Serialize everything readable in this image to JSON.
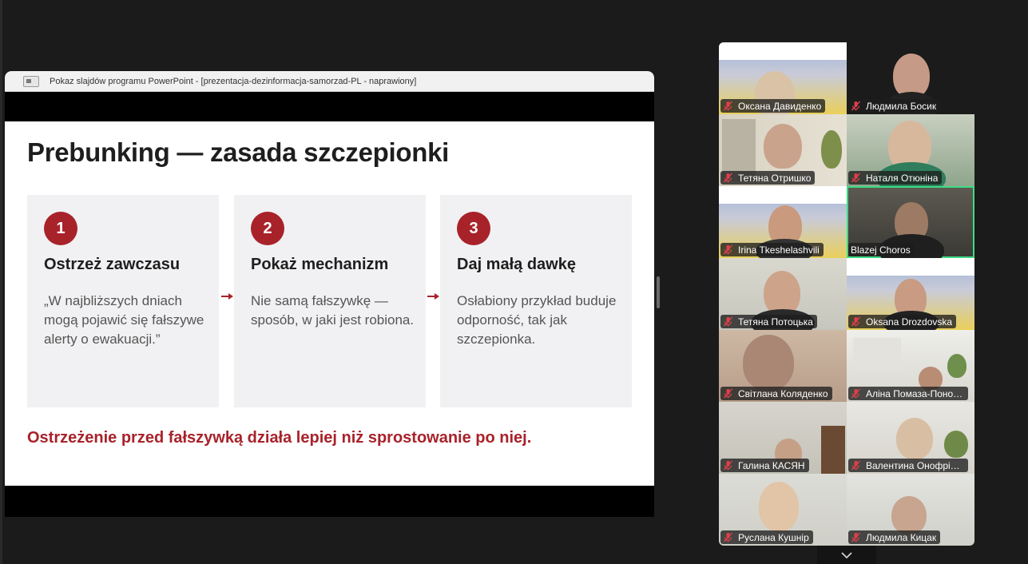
{
  "share": {
    "window_title": "Pokaz slajdów programu PowerPoint - [prezentacja-dezinformacja-samorzad-PL  -  naprawiony]"
  },
  "slide": {
    "title": "Prebunking — zasada szczepionki",
    "accent_color": "#a8222a",
    "cards": [
      {
        "number": "1",
        "heading": "Ostrzeż zawczasu",
        "body": "„W najbliższych dniach mogą pojawić się fałszywe alerty o ewakuacji.”"
      },
      {
        "number": "2",
        "heading": "Pokaż mechanizm",
        "body": "Nie samą fałszywkę — sposób, w jaki jest robiona."
      },
      {
        "number": "3",
        "heading": "Daj małą dawkę",
        "body": "Osłabiony przykład buduje odporność, tak jak szczepionka."
      }
    ],
    "footer": "Ostrzeżenie przed fałszywką działa lepiej niż sprostowanie po niej."
  },
  "participants": [
    {
      "name": "Оксана Давиденко",
      "muted": true
    },
    {
      "name": "Людмила Босик",
      "muted": true
    },
    {
      "name": "Тетяна Отришко",
      "muted": true
    },
    {
      "name": "Наталя Отюніна",
      "muted": true
    },
    {
      "name": "Irina Tkeshelashvili",
      "muted": true
    },
    {
      "name": "Blazej Choros",
      "muted": false,
      "active_speaker": true
    },
    {
      "name": "Тетяна Потоцька",
      "muted": true
    },
    {
      "name": "Oksana Drozdovska",
      "muted": true
    },
    {
      "name": "Світлана Коляденко",
      "muted": true
    },
    {
      "name": "Аліна Помаза-Пономаренко",
      "muted": true
    },
    {
      "name": "Галина КАСЯН",
      "muted": true
    },
    {
      "name": "Валентина Онофрійчук",
      "muted": true
    },
    {
      "name": "Руслана Кушнір",
      "muted": true
    },
    {
      "name": "Людмила Кицак",
      "muted": true
    }
  ],
  "colors": {
    "active_speaker_border": "#3ddc84",
    "muted_icon": "#e0404a"
  }
}
